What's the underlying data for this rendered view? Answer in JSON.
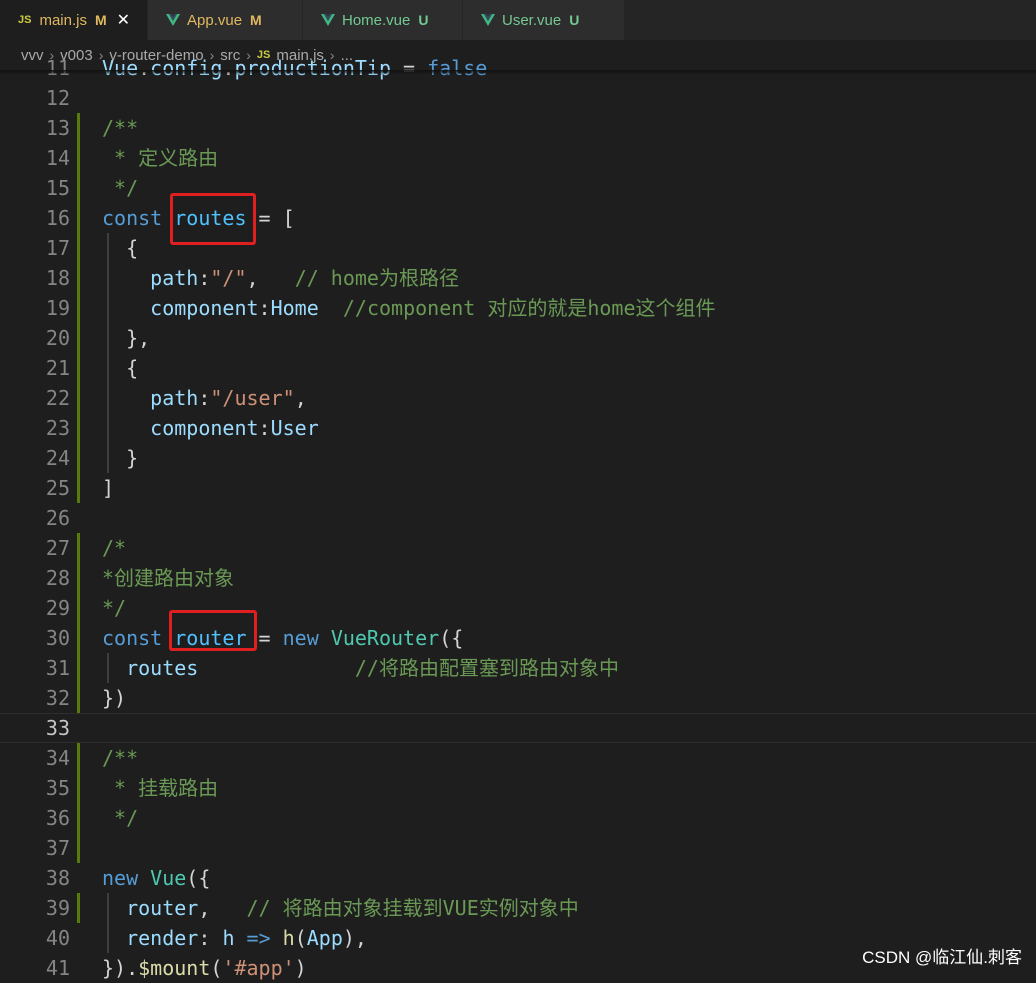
{
  "tabs": [
    {
      "icon": "JS",
      "name": "main.js",
      "status": "M",
      "active": true
    },
    {
      "icon": "vue",
      "name": "App.vue",
      "status": "M",
      "active": false
    },
    {
      "icon": "vue",
      "name": "Home.vue",
      "status": "U",
      "active": false
    },
    {
      "icon": "vue",
      "name": "User.vue",
      "status": "U",
      "active": false
    }
  ],
  "breadcrumb": [
    "vvv",
    "v003",
    "v-router-demo",
    "src"
  ],
  "breadcrumb_file": "main.js",
  "breadcrumb_tail": "...",
  "current_line": 33,
  "modified_lines": [
    13,
    14,
    15,
    16,
    17,
    18,
    19,
    20,
    21,
    22,
    23,
    24,
    25,
    27,
    28,
    29,
    30,
    31,
    32,
    34,
    35,
    36,
    37,
    39
  ],
  "highlight_boxes": [
    "routes",
    "router"
  ],
  "code_lines": [
    {
      "n": 11,
      "t": [
        [
          "v",
          "Vue"
        ],
        [
          "o",
          "."
        ],
        [
          "v",
          "config"
        ],
        [
          "o",
          "."
        ],
        [
          "v",
          "productionTip"
        ],
        [
          "o",
          " = "
        ],
        [
          "k",
          "false"
        ]
      ]
    },
    {
      "n": 12,
      "t": []
    },
    {
      "n": 13,
      "t": [
        [
          "c",
          "/**"
        ]
      ]
    },
    {
      "n": 14,
      "t": [
        [
          "c",
          " * 定义路由"
        ]
      ]
    },
    {
      "n": 15,
      "t": [
        [
          "c",
          " */"
        ]
      ]
    },
    {
      "n": 16,
      "t": [
        [
          "k",
          "const"
        ],
        [
          "o",
          " "
        ],
        [
          "ct",
          "routes"
        ],
        [
          "o",
          " = ["
        ]
      ]
    },
    {
      "n": 17,
      "t": [
        [
          "o",
          "  {"
        ]
      ]
    },
    {
      "n": 18,
      "t": [
        [
          "o",
          "    "
        ],
        [
          "v",
          "path"
        ],
        [
          "o",
          ":"
        ],
        [
          "s",
          "\"/\""
        ],
        [
          "o",
          ",   "
        ],
        [
          "c",
          "// home为根路径"
        ]
      ]
    },
    {
      "n": 19,
      "t": [
        [
          "o",
          "    "
        ],
        [
          "v",
          "component"
        ],
        [
          "o",
          ":"
        ],
        [
          "v",
          "Home"
        ],
        [
          "o",
          "  "
        ],
        [
          "c",
          "//component 对应的就是home这个组件"
        ]
      ]
    },
    {
      "n": 20,
      "t": [
        [
          "o",
          "  },"
        ]
      ]
    },
    {
      "n": 21,
      "t": [
        [
          "o",
          "  {"
        ]
      ]
    },
    {
      "n": 22,
      "t": [
        [
          "o",
          "    "
        ],
        [
          "v",
          "path"
        ],
        [
          "o",
          ":"
        ],
        [
          "s",
          "\"/user\""
        ],
        [
          "o",
          ","
        ]
      ]
    },
    {
      "n": 23,
      "t": [
        [
          "o",
          "    "
        ],
        [
          "v",
          "component"
        ],
        [
          "o",
          ":"
        ],
        [
          "v",
          "User"
        ]
      ]
    },
    {
      "n": 24,
      "t": [
        [
          "o",
          "  }"
        ]
      ]
    },
    {
      "n": 25,
      "t": [
        [
          "o",
          "]"
        ]
      ]
    },
    {
      "n": 26,
      "t": []
    },
    {
      "n": 27,
      "t": [
        [
          "c",
          "/*"
        ]
      ]
    },
    {
      "n": 28,
      "t": [
        [
          "c",
          "*创建路由对象"
        ]
      ]
    },
    {
      "n": 29,
      "t": [
        [
          "c",
          "*/"
        ]
      ]
    },
    {
      "n": 30,
      "t": [
        [
          "k",
          "const"
        ],
        [
          "o",
          " "
        ],
        [
          "ct",
          "router"
        ],
        [
          "o",
          " = "
        ],
        [
          "k",
          "new"
        ],
        [
          "o",
          " "
        ],
        [
          "t",
          "VueRouter"
        ],
        [
          "o",
          "({"
        ]
      ]
    },
    {
      "n": 31,
      "t": [
        [
          "o",
          "  "
        ],
        [
          "v",
          "routes"
        ],
        [
          "o",
          "             "
        ],
        [
          "c",
          "//将路由配置塞到路由对象中"
        ]
      ]
    },
    {
      "n": 32,
      "t": [
        [
          "o",
          "})"
        ]
      ]
    },
    {
      "n": 33,
      "t": []
    },
    {
      "n": 34,
      "t": [
        [
          "c",
          "/**"
        ]
      ]
    },
    {
      "n": 35,
      "t": [
        [
          "c",
          " * 挂载路由"
        ]
      ]
    },
    {
      "n": 36,
      "t": [
        [
          "c",
          " */"
        ]
      ]
    },
    {
      "n": 37,
      "t": []
    },
    {
      "n": 38,
      "t": [
        [
          "k",
          "new"
        ],
        [
          "o",
          " "
        ],
        [
          "t",
          "Vue"
        ],
        [
          "o",
          "({"
        ]
      ]
    },
    {
      "n": 39,
      "t": [
        [
          "o",
          "  "
        ],
        [
          "v",
          "router"
        ],
        [
          "o",
          ",   "
        ],
        [
          "c",
          "// 将路由对象挂载到VUE实例对象中"
        ]
      ]
    },
    {
      "n": 40,
      "t": [
        [
          "o",
          "  "
        ],
        [
          "v",
          "render"
        ],
        [
          "o",
          ": "
        ],
        [
          "v",
          "h"
        ],
        [
          "o",
          " "
        ],
        [
          "k",
          "=>"
        ],
        [
          "o",
          " "
        ],
        [
          "f",
          "h"
        ],
        [
          "o",
          "("
        ],
        [
          "v",
          "App"
        ],
        [
          "o",
          "),"
        ]
      ]
    },
    {
      "n": 41,
      "t": [
        [
          "o",
          "})."
        ],
        [
          "f",
          "$mount"
        ],
        [
          "o",
          "("
        ],
        [
          "s",
          "'#app'"
        ],
        [
          "o",
          ")"
        ]
      ]
    }
  ],
  "watermark": "CSDN @临江仙.刺客"
}
